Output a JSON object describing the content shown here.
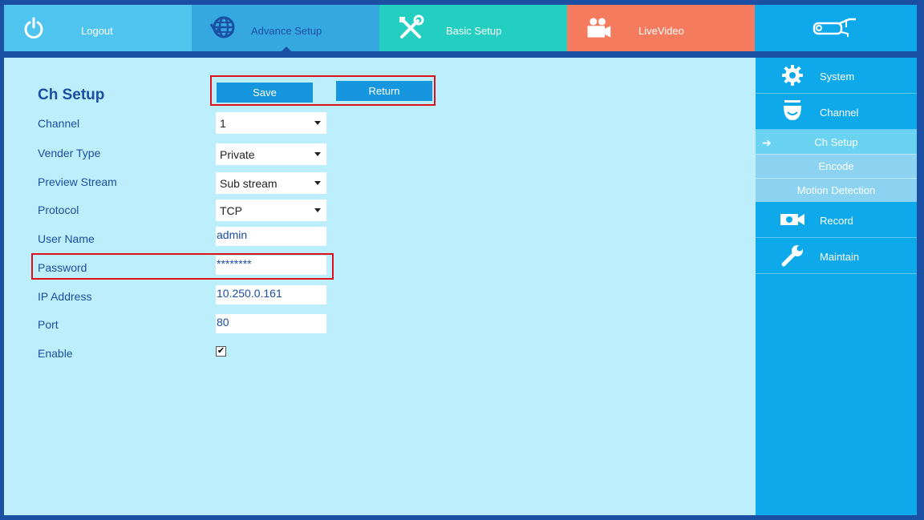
{
  "topnav": {
    "logout": "Logout",
    "advance_setup": "Advance Setup",
    "basic_setup": "Basic Setup",
    "live_video": "LiveVideo"
  },
  "page": {
    "title": "Ch Setup",
    "save_label": "Save",
    "return_label": "Return"
  },
  "form": {
    "channel_label": "Channel",
    "channel_value": "1",
    "vender_type_label": "Vender Type",
    "vender_type_value": "Private",
    "preview_stream_label": "Preview Stream",
    "preview_stream_value": "Sub stream",
    "protocol_label": "Protocol",
    "protocol_value": "TCP",
    "user_name_label": "User Name",
    "user_name_value": "admin",
    "password_label": "Password",
    "password_value": "********",
    "ip_address_label": "IP Address",
    "ip_address_value": "10.250.0.161",
    "port_label": "Port",
    "port_value": "80",
    "enable_label": "Enable",
    "enable_checked": true
  },
  "sidebar": {
    "system": "System",
    "channel": "Channel",
    "ch_setup": "Ch Setup",
    "encode": "Encode",
    "motion_detection": "Motion Detection",
    "record": "Record",
    "maintain": "Maintain"
  },
  "colors": {
    "frame": "#1a4fa3",
    "content_bg": "#bdeefc",
    "accent": "#1596de",
    "highlight": "#e0101a"
  }
}
